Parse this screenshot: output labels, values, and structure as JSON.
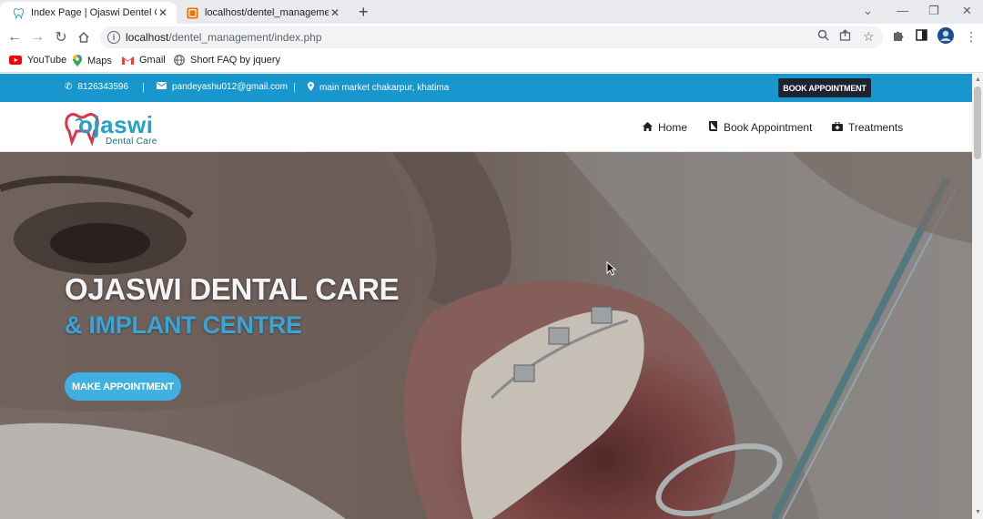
{
  "browser": {
    "tabs": [
      {
        "title": "Index Page | Ojaswi Dentel Care",
        "active": true,
        "icon": "tooth-favicon-icon"
      },
      {
        "title": "localhost/dentel_management/a",
        "active": false,
        "icon": "localhost-favicon-icon"
      }
    ],
    "new_tab": "+",
    "url_host": "localhost",
    "url_path": "/dentel_management/index.php",
    "bookmarks": [
      {
        "label": "YouTube",
        "icon": "youtube-icon"
      },
      {
        "label": "Maps",
        "icon": "maps-pin-icon"
      },
      {
        "label": "Gmail",
        "icon": "gmail-icon"
      },
      {
        "label": "Short FAQ by jquery",
        "icon": "globe-icon"
      }
    ]
  },
  "site": {
    "topbar": {
      "phone": "8126343596",
      "email": "pandeyashu012@gmail.com",
      "address": "main market chakarpur, khatima",
      "separator": "|",
      "book_button": "BOOK APPOINTMENT"
    },
    "logo": {
      "brand": "ojaswi",
      "brand_initial": "O",
      "sub": "Dental Care"
    },
    "nav": [
      {
        "label": "Home",
        "icon": "home-icon"
      },
      {
        "label": "Book Appointment",
        "icon": "book-icon"
      },
      {
        "label": "Treatments",
        "icon": "medkit-icon"
      }
    ],
    "hero": {
      "title": "OJASWI DENTAL CARE",
      "subtitle": "& IMPLANT CENTRE",
      "button": "MAKE APPOINTMENT"
    }
  },
  "colors": {
    "topbar": "#1797cd",
    "dark_button": "#1b2430",
    "accent_blue": "#3aa4d6",
    "hero_button": "#3fb0e0",
    "logo_red": "#d9354b"
  }
}
